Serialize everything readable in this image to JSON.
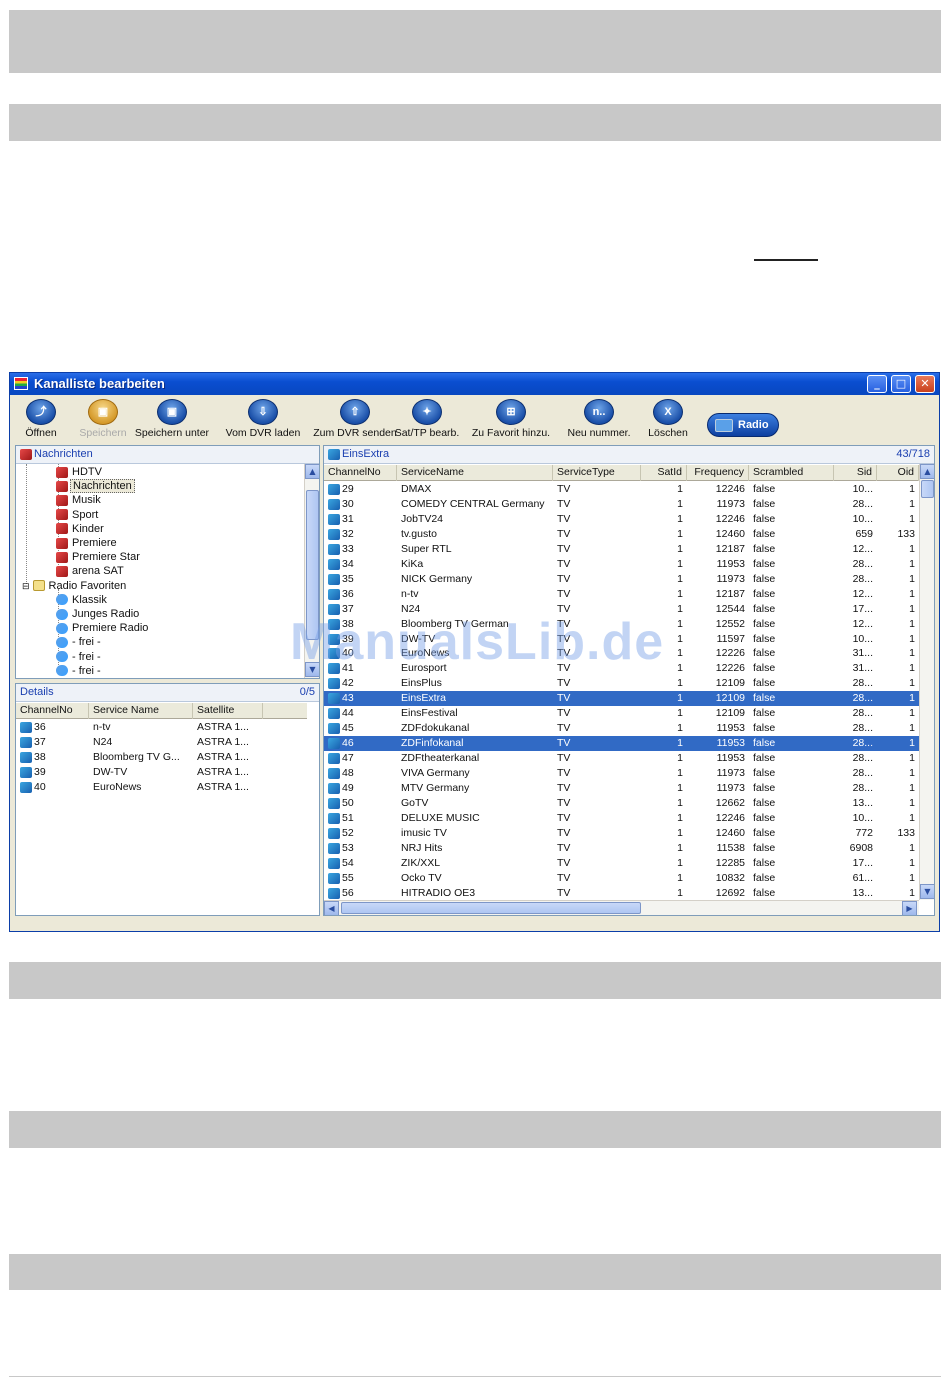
{
  "window": {
    "title": "Kanalliste bearbeiten",
    "controls": {
      "minimize": "_",
      "maximize": "□",
      "close": "✕"
    }
  },
  "toolbar": {
    "items": [
      {
        "label": "Öffnen",
        "icon": "open-icon",
        "glyph": "⤴",
        "disabled": false
      },
      {
        "label": "Speichern",
        "icon": "save-icon",
        "glyph": "▣",
        "disabled": true
      },
      {
        "label": "Speichern unter",
        "icon": "save-as-icon",
        "glyph": "▣",
        "disabled": false
      },
      {
        "label": "Vom DVR laden",
        "icon": "download-icon",
        "glyph": "⇩",
        "disabled": false
      },
      {
        "label": "Zum DVR senden",
        "icon": "upload-icon",
        "glyph": "⇧",
        "disabled": false
      },
      {
        "label": "Sat/TP bearb.",
        "icon": "satellite-icon",
        "glyph": "✦",
        "disabled": false
      },
      {
        "label": "Zu Favorit hinzu.",
        "icon": "add-favorite-icon",
        "glyph": "⊞",
        "disabled": false
      },
      {
        "label": "Neu nummer.",
        "icon": "renumber-icon",
        "glyph": "n..",
        "disabled": false
      },
      {
        "label": "Löschen",
        "icon": "delete-icon",
        "glyph": "X",
        "disabled": false
      }
    ],
    "radio_label": "Radio"
  },
  "tree": {
    "header": "Nachrichten",
    "items": [
      {
        "label": "HDTV",
        "type": "tv",
        "selected": false
      },
      {
        "label": "Nachrichten",
        "type": "tv",
        "selected": true
      },
      {
        "label": "Musik",
        "type": "tv",
        "selected": false
      },
      {
        "label": "Sport",
        "type": "tv",
        "selected": false
      },
      {
        "label": "Kinder",
        "type": "tv",
        "selected": false
      },
      {
        "label": "Premiere",
        "type": "tv",
        "selected": false
      },
      {
        "label": "Premiere Star",
        "type": "tv",
        "selected": false
      },
      {
        "label": "arena SAT",
        "type": "tv",
        "selected": false
      },
      {
        "label": "Radio Favoriten",
        "type": "folder",
        "selected": false
      },
      {
        "label": "Klassik",
        "type": "radio",
        "selected": false
      },
      {
        "label": "Junges Radio",
        "type": "radio",
        "selected": false
      },
      {
        "label": "Premiere Radio",
        "type": "radio",
        "selected": false
      },
      {
        "label": "- frei -",
        "type": "radio",
        "selected": false
      },
      {
        "label": "- frei -",
        "type": "radio",
        "selected": false
      },
      {
        "label": "- frei -",
        "type": "radio",
        "selected": false
      }
    ]
  },
  "details": {
    "header": "Details",
    "count": "0/5",
    "columns": [
      "ChannelNo",
      "Service Name",
      "Satellite"
    ],
    "rows": [
      [
        "36",
        "n-tv",
        "ASTRA 1..."
      ],
      [
        "37",
        "N24",
        "ASTRA 1..."
      ],
      [
        "38",
        "Bloomberg TV G...",
        "ASTRA 1..."
      ],
      [
        "39",
        "DW-TV",
        "ASTRA 1..."
      ],
      [
        "40",
        "EuroNews",
        "ASTRA 1..."
      ]
    ]
  },
  "channels": {
    "header": "EinsExtra",
    "count": "43/718",
    "columns": [
      "ChannelNo",
      "ServiceName",
      "ServiceType",
      "SatId",
      "Frequency",
      "Scrambled",
      "Sid",
      "Oid"
    ],
    "rows": [
      [
        "29",
        "DMAX",
        "TV",
        "1",
        "12246",
        "false",
        "10...",
        "1"
      ],
      [
        "30",
        "COMEDY CENTRAL Germany",
        "TV",
        "1",
        "11973",
        "false",
        "28...",
        "1"
      ],
      [
        "31",
        "JobTV24",
        "TV",
        "1",
        "12246",
        "false",
        "10...",
        "1"
      ],
      [
        "32",
        "tv.gusto",
        "TV",
        "1",
        "12460",
        "false",
        "659",
        "133"
      ],
      [
        "33",
        "Super RTL",
        "TV",
        "1",
        "12187",
        "false",
        "12...",
        "1"
      ],
      [
        "34",
        "KiKa",
        "TV",
        "1",
        "11953",
        "false",
        "28...",
        "1"
      ],
      [
        "35",
        "NICK Germany",
        "TV",
        "1",
        "11973",
        "false",
        "28...",
        "1"
      ],
      [
        "36",
        "n-tv",
        "TV",
        "1",
        "12187",
        "false",
        "12...",
        "1"
      ],
      [
        "37",
        "N24",
        "TV",
        "1",
        "12544",
        "false",
        "17...",
        "1"
      ],
      [
        "38",
        "Bloomberg TV German",
        "TV",
        "1",
        "12552",
        "false",
        "12...",
        "1"
      ],
      [
        "39",
        "DW-TV",
        "TV",
        "1",
        "11597",
        "false",
        "10...",
        "1"
      ],
      [
        "40",
        "EuroNews",
        "TV",
        "1",
        "12226",
        "false",
        "31...",
        "1"
      ],
      [
        "41",
        "Eurosport",
        "TV",
        "1",
        "12226",
        "false",
        "31...",
        "1"
      ],
      [
        "42",
        "EinsPlus",
        "TV",
        "1",
        "12109",
        "false",
        "28...",
        "1"
      ],
      [
        "43",
        "EinsExtra",
        "TV",
        "1",
        "12109",
        "false",
        "28...",
        "1"
      ],
      [
        "44",
        "EinsFestival",
        "TV",
        "1",
        "12109",
        "false",
        "28...",
        "1"
      ],
      [
        "45",
        "ZDFdokukanal",
        "TV",
        "1",
        "11953",
        "false",
        "28...",
        "1"
      ],
      [
        "46",
        "ZDFinfokanal",
        "TV",
        "1",
        "11953",
        "false",
        "28...",
        "1"
      ],
      [
        "47",
        "ZDFtheaterkanal",
        "TV",
        "1",
        "11953",
        "false",
        "28...",
        "1"
      ],
      [
        "48",
        "VIVA Germany",
        "TV",
        "1",
        "11973",
        "false",
        "28...",
        "1"
      ],
      [
        "49",
        "MTV Germany",
        "TV",
        "1",
        "11973",
        "false",
        "28...",
        "1"
      ],
      [
        "50",
        "GoTV",
        "TV",
        "1",
        "12662",
        "false",
        "13...",
        "1"
      ],
      [
        "51",
        "DELUXE MUSIC",
        "TV",
        "1",
        "12246",
        "false",
        "10...",
        "1"
      ],
      [
        "52",
        "imusic TV",
        "TV",
        "1",
        "12460",
        "false",
        "772",
        "133"
      ],
      [
        "53",
        "NRJ Hits",
        "TV",
        "1",
        "11538",
        "false",
        "6908",
        "1"
      ],
      [
        "54",
        "ZIK/XXL",
        "TV",
        "1",
        "12285",
        "false",
        "17...",
        "1"
      ],
      [
        "55",
        "Ocko TV",
        "TV",
        "1",
        "10832",
        "false",
        "61...",
        "1"
      ],
      [
        "56",
        "HITRADIO OE3",
        "TV",
        "1",
        "12692",
        "false",
        "13...",
        "1"
      ]
    ],
    "selected_rows": [
      "43",
      "46"
    ]
  },
  "watermark": "ManualsLib.de",
  "colors": {
    "title_bar": "#0a4ed0",
    "selection": "#316ac5",
    "panel_header_text": "#1a3fb0",
    "band": "#c8c8c8"
  }
}
